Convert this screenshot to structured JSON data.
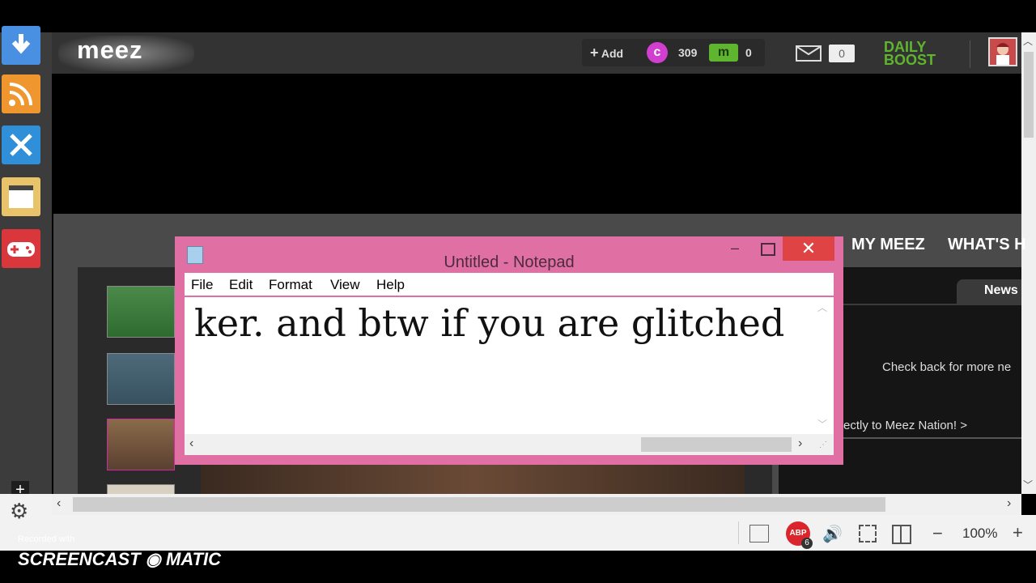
{
  "header": {
    "logo": "meez",
    "add_label": "Add",
    "coins": "309",
    "meez_points": "0",
    "mail_count": "0",
    "daily_boost_line1": "DAILY",
    "daily_boost_line2": "BOOST"
  },
  "site_nav": {
    "my_meez": "MY MEEZ",
    "whats_hot": "WHAT'S H"
  },
  "news": {
    "tab": "News",
    "check_back": "Check back for more ne",
    "link": "ectly to Meez Nation! >"
  },
  "notepad": {
    "title": "Untitled - Notepad",
    "menu": [
      "File",
      "Edit",
      "Format",
      "View",
      "Help"
    ],
    "content": "ker. and btw if you are glitched"
  },
  "statusbar": {
    "zoom": "100%",
    "abp_badge": "ABP",
    "abp_count": "6"
  },
  "watermark": {
    "recorded_with": "Recorded with",
    "brand": "SCREENCAST ◉ MATIC"
  },
  "colors": {
    "sidebar_download": "#4a90e2",
    "sidebar_rss": "#f0962e",
    "sidebar_tools": "#2f8fd8",
    "sidebar_notes": "#e8c36a",
    "sidebar_games": "#d9373c",
    "notepad_frame": "#e070a4",
    "notepad_close": "#e04343",
    "daily_boost": "#5fb52e"
  }
}
